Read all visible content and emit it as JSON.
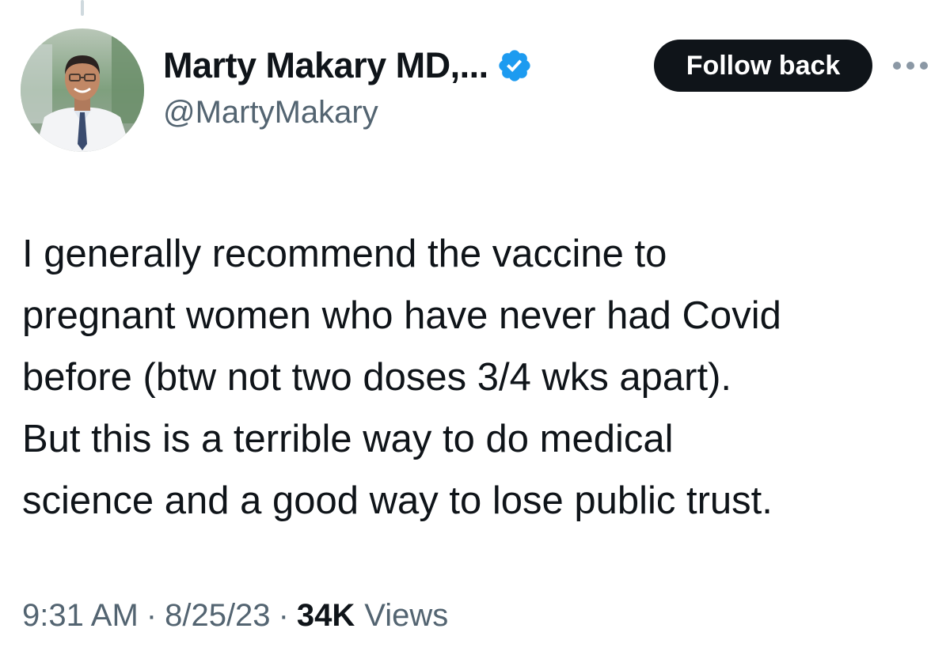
{
  "tweet": {
    "author": {
      "display_name": "Marty Makary MD,...",
      "handle": "@MartyMakary",
      "verified_icon": "verified-badge-icon",
      "avatar_icon": "avatar-photo"
    },
    "follow_label": "Follow back",
    "more_icon": "more-options-icon",
    "text": "I generally recommend the vaccine to\npregnant women who have never had Covid\nbefore (btw not two doses 3/4 wks apart).\nBut this is a terrible way to do medical\nscience and a good way to lose public trust.",
    "meta": {
      "time": "9:31 AM",
      "date": "8/25/23",
      "separator": "·",
      "views_count": "34K",
      "views_label": "Views"
    }
  },
  "colors": {
    "verified_blue": "#1d9bf0",
    "button_bg": "#0f1419",
    "secondary_text": "#536471"
  }
}
